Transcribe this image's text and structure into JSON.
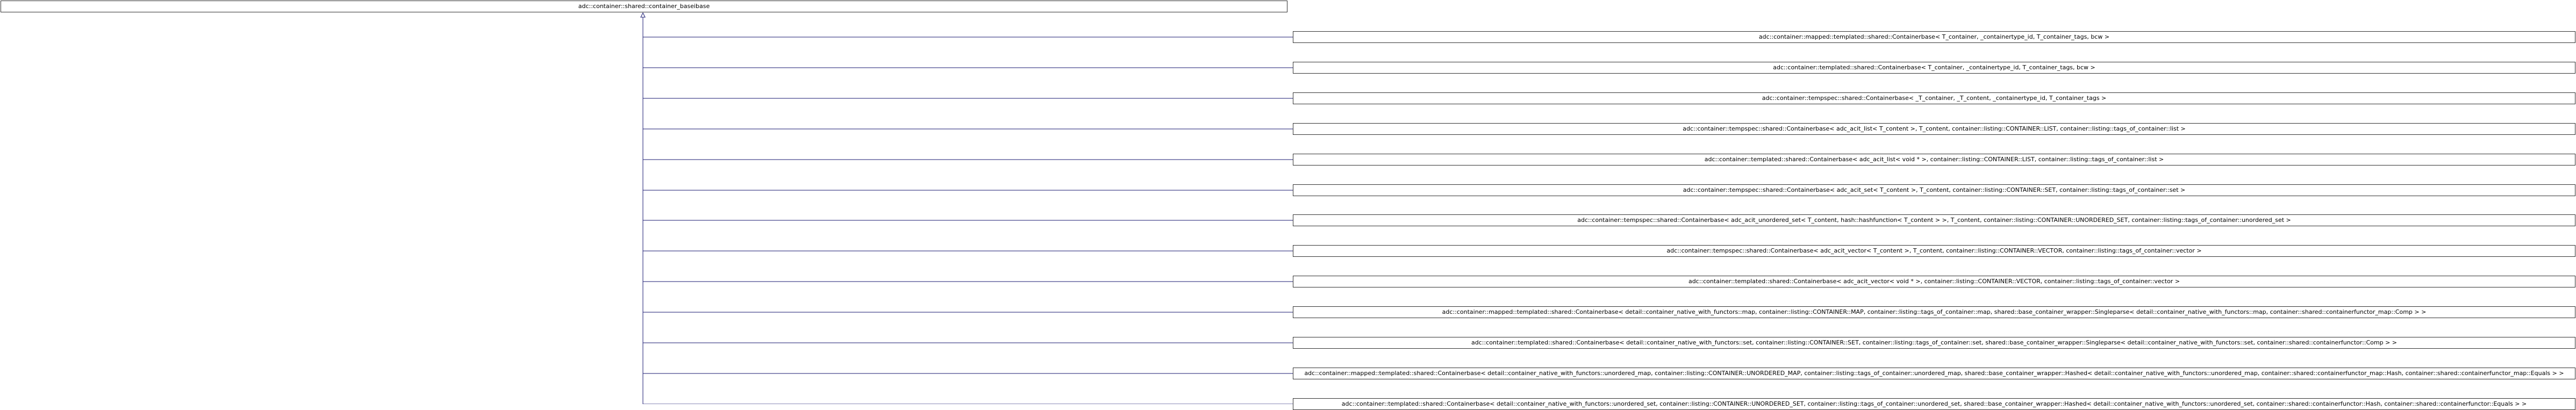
{
  "root": {
    "label": "adc::container::shared::container_baseibase"
  },
  "children": [
    {
      "label": "adc::container::mapped::templated::shared::Containerbase< T_container, _containertype_id, T_container_tags, bcw >"
    },
    {
      "label": "adc::container::templated::shared::Containerbase< T_container, _containertype_id, T_container_tags, bcw >"
    },
    {
      "label": "adc::container::tempspec::shared::Containerbase< _T_container, _T_content, _containertype_id, T_container_tags >"
    },
    {
      "label": "adc::container::tempspec::shared::Containerbase< adc_acit_list< T_content >, T_content, container::listing::CONTAINER::LIST, container::listing::tags_of_container::list >"
    },
    {
      "label": "adc::container::templated::shared::Containerbase< adc_acit_list< void * >, container::listing::CONTAINER::LIST, container::listing::tags_of_container::list >"
    },
    {
      "label": "adc::container::tempspec::shared::Containerbase< adc_acit_set< T_content >, T_content, container::listing::CONTAINER::SET, container::listing::tags_of_container::set >"
    },
    {
      "label": "adc::container::tempspec::shared::Containerbase< adc_acit_unordered_set< T_content, hash::hashfunction< T_content > >, T_content, container::listing::CONTAINER::UNORDERED_SET, container::listing::tags_of_container::unordered_set >"
    },
    {
      "label": "adc::container::tempspec::shared::Containerbase< adc_acit_vector< T_content >, T_content, container::listing::CONTAINER::VECTOR, container::listing::tags_of_container::vector >"
    },
    {
      "label": "adc::container::templated::shared::Containerbase< adc_acit_vector< void * >, container::listing::CONTAINER::VECTOR, container::listing::tags_of_container::vector >"
    },
    {
      "label": "adc::container::mapped::templated::shared::Containerbase< detail::container_native_with_functors::map, container::listing::CONTAINER::MAP, container::listing::tags_of_container::map, shared::base_container_wrapper::Singleparse< detail::container_native_with_functors::map, container::shared::containerfunctor_map::Comp > >"
    },
    {
      "label": "adc::container::templated::shared::Containerbase< detail::container_native_with_functors::set, container::listing::CONTAINER::SET, container::listing::tags_of_container::set, shared::base_container_wrapper::Singleparse< detail::container_native_with_functors::set, container::shared::containerfunctor::Comp > >"
    },
    {
      "label": "adc::container::mapped::templated::shared::Containerbase< detail::container_native_with_functors::unordered_map, container::listing::CONTAINER::UNORDERED_MAP, container::listing::tags_of_container::unordered_map, shared::base_container_wrapper::Hashed< detail::container_native_with_functors::unordered_map, container::shared::containerfunctor_map::Hash, container::shared::containerfunctor_map::Equals > >"
    },
    {
      "label": "adc::container::templated::shared::Containerbase< detail::container_native_with_functors::unordered_set, container::listing::CONTAINER::UNORDERED_SET, container::listing::tags_of_container::unordered_set, shared::base_container_wrapper::Hashed< detail::container_native_with_functors::unordered_set, container::shared::containerfunctor::Hash, container::shared::containerfunctor::Equals > >"
    }
  ],
  "colors": {
    "edge": "#191970",
    "border": "#333333",
    "background": "#ffffff",
    "text": "#000000"
  }
}
